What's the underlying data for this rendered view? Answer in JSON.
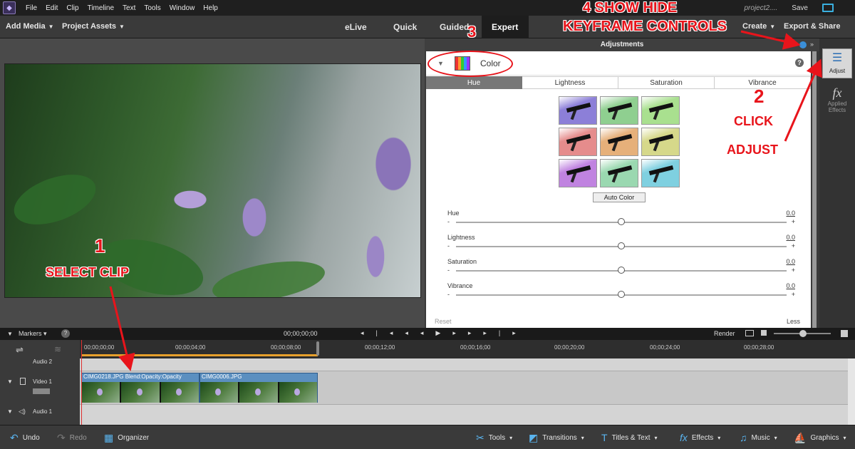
{
  "menubar": {
    "items": [
      "File",
      "Edit",
      "Clip",
      "Timeline",
      "Text",
      "Tools",
      "Window",
      "Help"
    ],
    "project_name": "project2....",
    "save_label": "Save"
  },
  "topbar": {
    "add_media": "Add Media",
    "project_assets": "Project Assets",
    "modes": [
      "eLive",
      "Quick",
      "Guided",
      "Expert"
    ],
    "active_mode": "Expert",
    "create": "Create",
    "export_share": "Export & Share"
  },
  "adjustments": {
    "title": "Adjustments",
    "section": "Color",
    "tabs": [
      "Hue",
      "Lightness",
      "Saturation",
      "Vibrance"
    ],
    "active_tab": "Hue",
    "swatch_colors": [
      "#8c7fd8",
      "#8fcf90",
      "#a9e08f",
      "#e58c8c",
      "#e6b07a",
      "#d6d88a",
      "#c083e0",
      "#9ad8b0",
      "#7fd0e0"
    ],
    "auto_color": "Auto Color",
    "sliders": [
      {
        "label": "Hue",
        "value": "0.0",
        "level": 0.5
      },
      {
        "label": "Lightness",
        "value": "0.0",
        "level": 0.5
      },
      {
        "label": "Saturation",
        "value": "0.0",
        "level": 0.5
      },
      {
        "label": "Vibrance",
        "value": "0.0",
        "level": 0.5
      }
    ],
    "minus": "-",
    "plus": "+",
    "reset": "Reset",
    "less": "Less"
  },
  "right_strip": {
    "adjust": "Adjust",
    "applied_effects": "Applied Effects",
    "fx_glyph": "fx"
  },
  "timeline": {
    "markers": "Markers",
    "timecode": "00;00;00;00",
    "render": "Render",
    "ruler": [
      "00;00;00;00",
      "00;00;04;00",
      "00;00;08;00",
      "00;00;12;00",
      "00;00;16;00",
      "00;00;20;00",
      "00;00;24;00",
      "00;00;28;00"
    ],
    "tracks": {
      "audio2": "Audio 2",
      "video1": "Video 1",
      "audio1": "Audio 1"
    },
    "clip1_label": "CIMG0218.JPG  Blend:Opacity:Opacity",
    "clip2_label": "CIMG0006.JPG"
  },
  "bottombar": {
    "undo": "Undo",
    "redo": "Redo",
    "organizer": "Organizer",
    "tools": "Tools",
    "transitions": "Transitions",
    "titles_text": "Titles & Text",
    "effects": "Effects",
    "music": "Music",
    "graphics": "Graphics"
  },
  "annotations": {
    "step1_num": "1",
    "step1_text": "SELECT CLIP",
    "step2_num": "2",
    "step2_text1": "CLICK",
    "step2_text2": "ADJUST",
    "step3_num": "3",
    "step4_title": "4  SHOW HIDE",
    "step4_text": "KEYFRAME CONTROLS"
  },
  "colors": {
    "accent_blue": "#5ab4ef",
    "annotation_red": "#e8141b",
    "clip_blue": "#5b8fc0"
  }
}
